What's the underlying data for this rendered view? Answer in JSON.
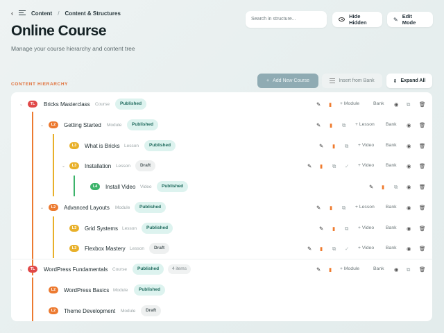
{
  "breadcrumb": {
    "back": "‹",
    "section": "Content",
    "sep": "/",
    "page": "Content & Structures"
  },
  "title": "Online Course",
  "subtitle": "Manage your course hierarchy and content tree",
  "search": {
    "placeholder": "Search in structure..."
  },
  "buttons": {
    "hide_hidden": "Hide Hidden",
    "edit_mode": "Edit Mode",
    "add_new": "Add New Course",
    "insert_bank": "Insert from Bank",
    "expand_all": "Expand All"
  },
  "section_label": "CONTENT HIERARCHY",
  "colors": {
    "course": "#e04848",
    "module": "#ec7a30",
    "lesson": "#e8b02a",
    "video": "#3cb36a",
    "published_bg": "#ddf3ef"
  },
  "rows": [
    {
      "level": "TL",
      "name": "Bricks Masterclass",
      "type": "Course",
      "status": "Published",
      "add": "+ Module",
      "bank": "Bank"
    },
    {
      "level": "L2",
      "name": "Getting Started",
      "type": "Module",
      "status": "Published",
      "add": "+ Lesson",
      "bank": "Bank"
    },
    {
      "level": "L3",
      "name": "What is Bricks",
      "type": "Lesson",
      "status": "Published",
      "add": "+ Video",
      "bank": "Bank"
    },
    {
      "level": "L3",
      "name": "Installation",
      "type": "Lesson",
      "status": "Draft",
      "add": "+ Video",
      "bank": "Bank"
    },
    {
      "level": "L4",
      "name": "Install Video",
      "type": "Video",
      "status": "Published"
    },
    {
      "level": "L2",
      "name": "Advanced Layouts",
      "type": "Module",
      "status": "Published",
      "add": "+ Lesson",
      "bank": "Bank"
    },
    {
      "level": "L3",
      "name": "Grid Systems",
      "type": "Lesson",
      "status": "Published",
      "add": "+ Video",
      "bank": "Bank"
    },
    {
      "level": "L3",
      "name": "Flexbox Mastery",
      "type": "Lesson",
      "status": "Draft",
      "add": "+ Video",
      "bank": "Bank"
    },
    {
      "level": "TL",
      "name": "WordPress Fundamentals",
      "type": "Course",
      "status": "Published",
      "count": "4 items",
      "add": "+ Module",
      "bank": "Bank"
    },
    {
      "level": "L2",
      "name": "WordPress Basics",
      "type": "Module",
      "status": "Published"
    },
    {
      "level": "L2",
      "name": "Theme Development",
      "type": "Module",
      "status": "Draft"
    }
  ]
}
